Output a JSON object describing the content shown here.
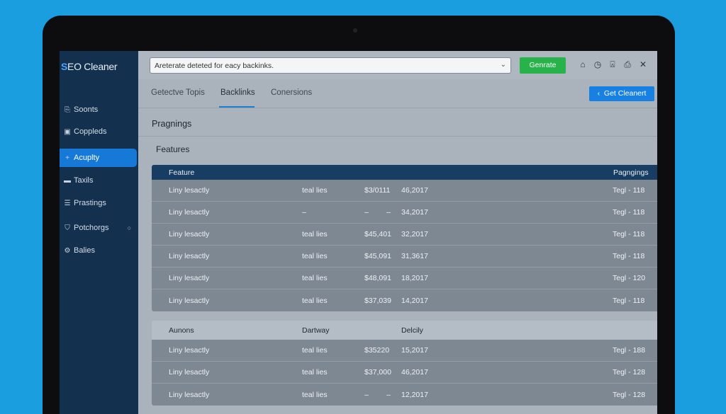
{
  "app": {
    "logo_mark": "S",
    "logo_text": "EO Cleaner"
  },
  "sidebar": {
    "items": [
      {
        "label": "Soonts",
        "icon": "doc-icon"
      },
      {
        "label": "Coppleds",
        "icon": "clipboard-icon"
      },
      {
        "label": "Acuplty",
        "icon": "plus-icon",
        "active": true
      },
      {
        "label": "Taxils",
        "icon": "folder-icon"
      },
      {
        "label": "Prastings",
        "icon": "list-icon"
      },
      {
        "label": "Potchorgs",
        "icon": "shield-icon",
        "badge": "○"
      },
      {
        "label": "Balies",
        "icon": "gear-icon"
      }
    ]
  },
  "toolbar": {
    "search_value": "Areterate deteted for eacy backinks.",
    "generate_label": "Genrate",
    "icons": [
      "home-icon",
      "clock-icon",
      "bookmark-icon",
      "print-icon",
      "close-icon"
    ]
  },
  "tabs": {
    "items": [
      "Getectve Topis",
      "Backlinks",
      "Conersions"
    ],
    "active_index": 1,
    "cta_label": "Get Cleanert"
  },
  "main": {
    "section_title": "Pragnings",
    "features_title": "Features"
  },
  "table1": {
    "headers": {
      "feature": "Feature",
      "pagings": "Pagngings"
    },
    "rows": [
      {
        "name": "Liny lesactly",
        "type": "teal lies",
        "amount": "$3/0111",
        "date": "46,2017",
        "tag": "Tegl - 118"
      },
      {
        "name": "Liny lesactly",
        "type": "–",
        "amount": "–",
        "date": "34,2017",
        "tag": "Tegl - 118",
        "amount_prefix": "–"
      },
      {
        "name": "Liny lesactly",
        "type": "teal lies",
        "amount": "$45,401",
        "date": "32,2017",
        "tag": "Tegl - 118"
      },
      {
        "name": "Liny lesactly",
        "type": "teal lies",
        "amount": "$45,091",
        "date": "31,3617",
        "tag": "Tegl - 118"
      },
      {
        "name": "Liny lesactly",
        "type": "teal lies",
        "amount": "$48,091",
        "date": "18,2017",
        "tag": "Tegl - 120"
      },
      {
        "name": "Liny lesactly",
        "type": "teal lies",
        "amount": "$37,039",
        "date": "14,2017",
        "tag": "Tegl - 118"
      }
    ]
  },
  "table2": {
    "headers": {
      "col1": "Aunons",
      "col2": "Dartway",
      "col3": "Delcily"
    },
    "rows": [
      {
        "name": "Liny lesactly",
        "type": "teal lies",
        "amount": "$35220",
        "date": "15,2017",
        "tag": "Tegl - 188"
      },
      {
        "name": "Liny lesactly",
        "type": "teal lies",
        "amount": "$37,000",
        "date": "46,2017",
        "tag": "Tegl - 128"
      },
      {
        "name": "Liny lesactly",
        "type": "teal lies",
        "amount": "–",
        "date": "12,2017",
        "tag": "Tegl - 128",
        "amount_prefix": "–"
      }
    ]
  }
}
